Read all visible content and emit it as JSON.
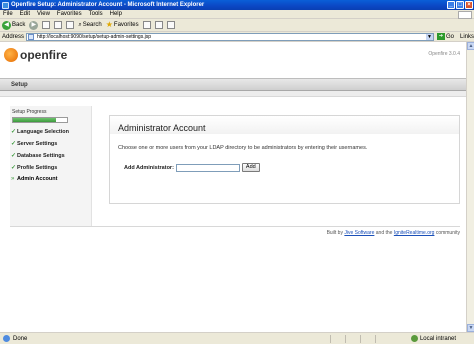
{
  "window": {
    "title": "Openfire Setup: Administrator Account - Microsoft Internet Explorer",
    "buttons": [
      "_",
      "□",
      "×"
    ]
  },
  "menubar": {
    "items": [
      "File",
      "Edit",
      "View",
      "Favorites",
      "Tools",
      "Help"
    ]
  },
  "toolbar": {
    "back_label": "Back",
    "search_label": "Search",
    "favorites_label": "Favorites"
  },
  "address": {
    "label": "Address",
    "url": "http://localhost:9090/setup/setup-admin-settings.jsp",
    "go_label": "Go",
    "links_label": "Links"
  },
  "page": {
    "brand": "openfire",
    "version": "Openfire 3.0.4",
    "nav_tab": "Setup",
    "sidebar": {
      "progress_title": "Setup Progress",
      "progress_fraction": 0.8,
      "steps": [
        {
          "label": "Language Selection",
          "done": true
        },
        {
          "label": "Server Settings",
          "done": true
        },
        {
          "label": "Database Settings",
          "done": true
        },
        {
          "label": "Profile Settings",
          "done": true
        },
        {
          "label": "Admin Account",
          "done": false
        }
      ]
    },
    "content": {
      "heading": "Administrator Account",
      "description": "Choose one or more users from your LDAP directory to be administrators by entering their usernames.",
      "field_label": "Add Administrator:",
      "field_value": "",
      "add_button": "Add"
    },
    "footer": {
      "prefix": "Built by",
      "link1": "Jive Software",
      "middle": "and the",
      "link2": "IgniteRealtime.org",
      "suffix": "community"
    }
  },
  "status": {
    "text": "Done",
    "zone": "Local intranet"
  }
}
